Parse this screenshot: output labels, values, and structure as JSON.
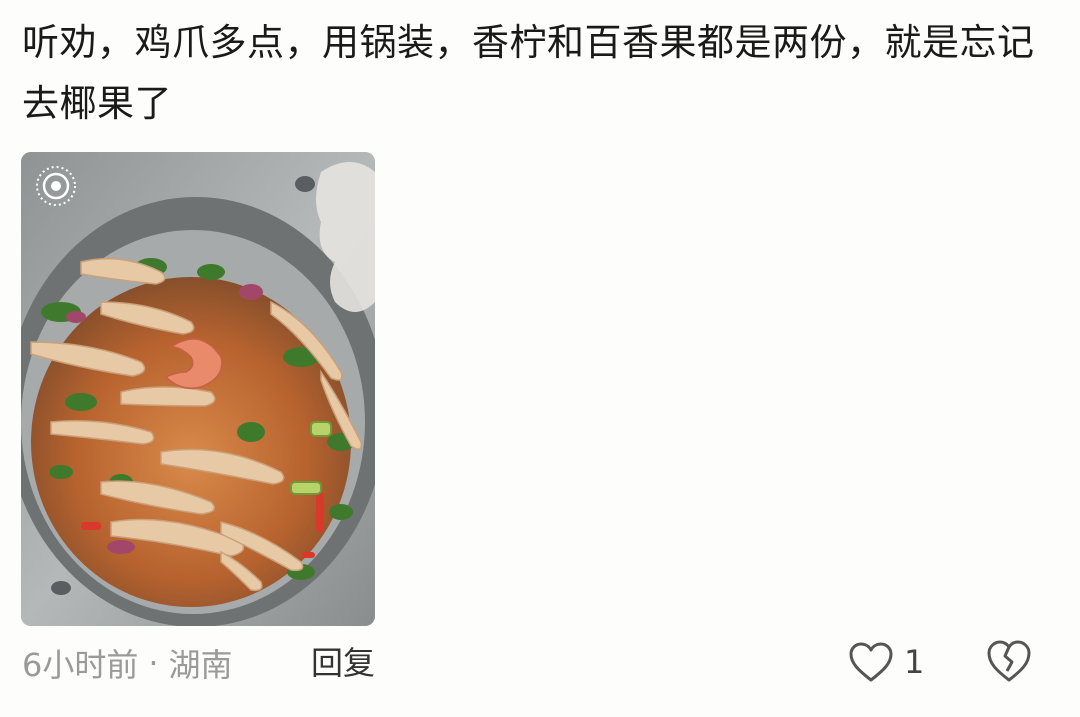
{
  "comment": {
    "text": "听劝，鸡爪多点，用锅装，香柠和百香果都是两份，就是忘记去椰果了",
    "time": "6小时前",
    "separator": "·",
    "location": "湖南",
    "reply_label": "回复",
    "like_count": "1",
    "image": {
      "icon": "live-photo-icon"
    }
  },
  "colors": {
    "text": "#1a1a1a",
    "meta": "#9a9a9a",
    "icon": "#555555",
    "background": "#fdfdfb"
  }
}
